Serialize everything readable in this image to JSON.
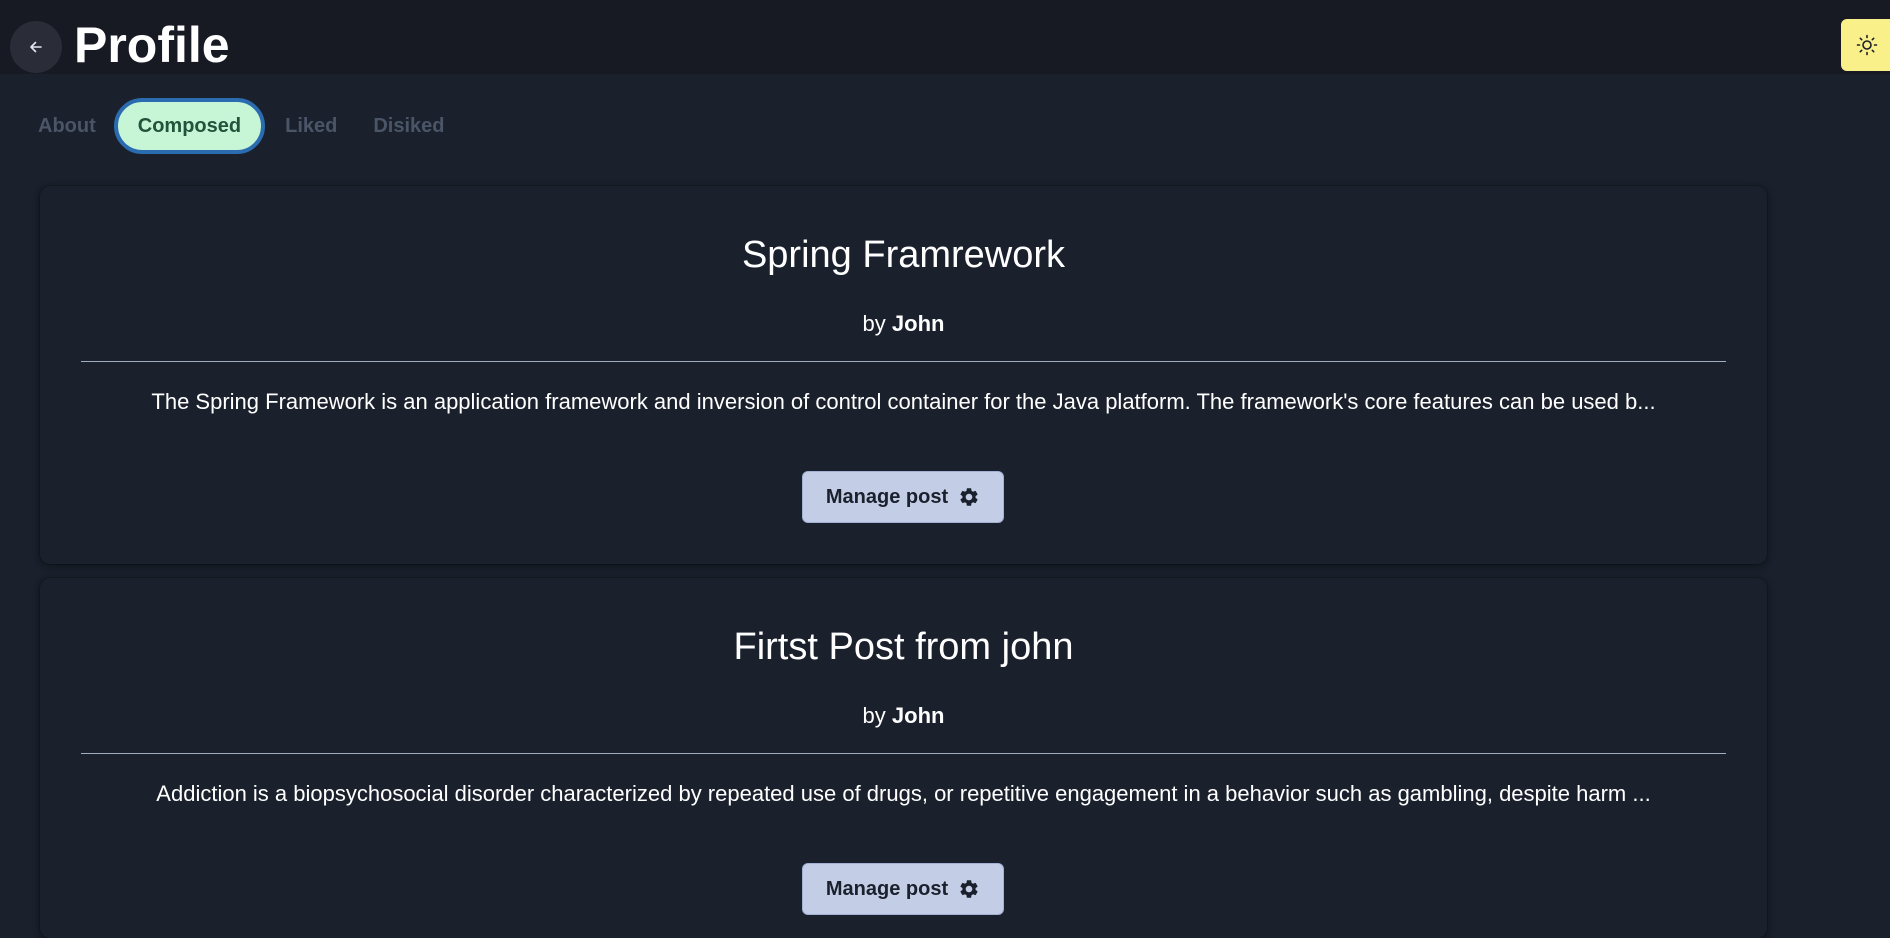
{
  "header": {
    "title": "Profile"
  },
  "tabs": [
    {
      "label": "About",
      "active": false
    },
    {
      "label": "Composed",
      "active": true
    },
    {
      "label": "Liked",
      "active": false
    },
    {
      "label": "Disiked",
      "active": false
    }
  ],
  "posts": [
    {
      "title": "Spring Framrework",
      "by_prefix": "by",
      "author": "John",
      "excerpt": "The Spring Framework is an application framework and inversion of control container for the Java platform. The framework's core features can be used b...",
      "manage_label": "Manage post"
    },
    {
      "title": "Firtst Post from john",
      "by_prefix": "by",
      "author": "John",
      "excerpt": "Addiction is a biopsychosocial disorder characterized by repeated use of drugs, or repetitive engagement in a behavior such as gambling, despite harm ...",
      "manage_label": "Manage post"
    }
  ],
  "icons": {
    "back": "arrow-left-icon",
    "theme": "sun-icon",
    "manage": "gear-icon"
  },
  "colors": {
    "background": "#1a202c",
    "header": "#171923",
    "active_tab_bg": "#c6f6d5",
    "active_tab_text": "#22543d",
    "active_tab_border": "#2b6cb0",
    "theme_toggle": "#faf089",
    "manage_button": "#c3cde6"
  }
}
